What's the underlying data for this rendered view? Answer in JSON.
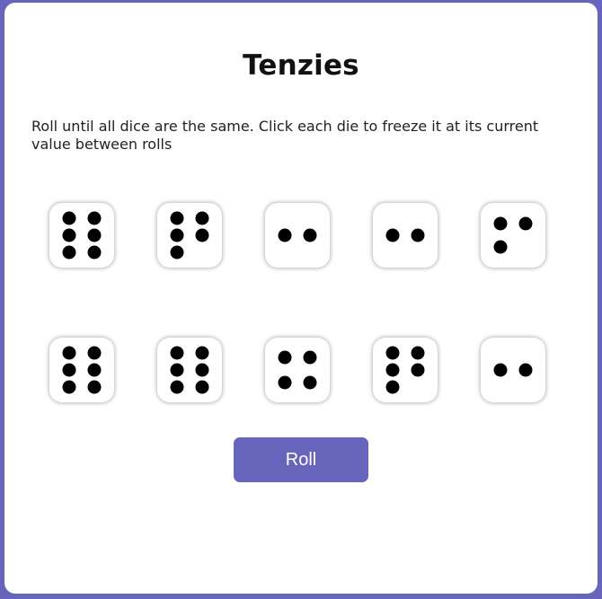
{
  "app": {
    "title": "Tenzies",
    "instructions": "Roll until all dice are the same. Click each die to freeze it at its current value between rolls"
  },
  "dice": [
    6,
    5,
    2,
    2,
    3,
    6,
    6,
    4,
    5,
    2
  ],
  "roll_button": {
    "label": "Roll"
  },
  "colors": {
    "accent": "#6765bb",
    "background": "#6765bb",
    "card": "#ffffff",
    "pip": "#000000"
  }
}
